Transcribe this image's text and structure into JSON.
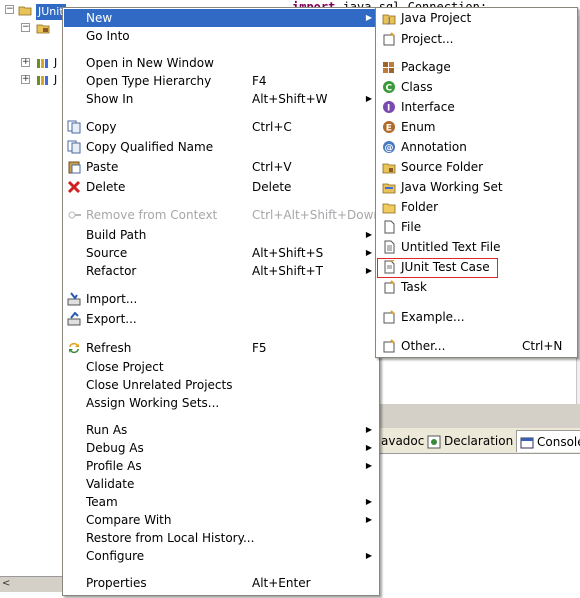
{
  "tree": {
    "selected_label": "JUnit",
    "row2_glyph": "J",
    "row3_glyph": "J"
  },
  "editor": {
    "keyword": "import",
    "code": " java.sql.Connection;"
  },
  "bottom_tabs": [
    {
      "label": "avadoc",
      "icon": "javadoc-icon"
    },
    {
      "label": "Declaration",
      "icon": "declaration-icon"
    },
    {
      "label": "Console",
      "icon": "console-icon"
    }
  ],
  "context_menu": {
    "items": [
      {
        "label": "New",
        "submenu": true,
        "highlight": true
      },
      {
        "label": "Go Into"
      },
      {
        "label": "Open in New Window"
      },
      {
        "label": "Open Type Hierarchy",
        "accel": "F4"
      },
      {
        "label": "Show In",
        "accel": "Alt+Shift+W",
        "submenu": true
      },
      {
        "label": "Copy",
        "accel": "Ctrl+C",
        "icon": "copy-icon"
      },
      {
        "label": "Copy Qualified Name",
        "icon": "copy-qualified-icon"
      },
      {
        "label": "Paste",
        "accel": "Ctrl+V",
        "icon": "paste-icon"
      },
      {
        "label": "Delete",
        "accel": "Delete",
        "icon": "delete-icon"
      },
      {
        "label": "Remove from Context",
        "accel": "Ctrl+Alt+Shift+Down",
        "disabled": true,
        "icon": "remove-context-icon"
      },
      {
        "label": "Build Path",
        "submenu": true
      },
      {
        "label": "Source",
        "accel": "Alt+Shift+S",
        "submenu": true
      },
      {
        "label": "Refactor",
        "accel": "Alt+Shift+T",
        "submenu": true
      },
      {
        "label": "Import...",
        "icon": "import-icon"
      },
      {
        "label": "Export...",
        "icon": "export-icon"
      },
      {
        "label": "Refresh",
        "accel": "F5",
        "icon": "refresh-icon"
      },
      {
        "label": "Close Project"
      },
      {
        "label": "Close Unrelated Projects"
      },
      {
        "label": "Assign Working Sets..."
      },
      {
        "label": "Run As",
        "submenu": true
      },
      {
        "label": "Debug As",
        "submenu": true
      },
      {
        "label": "Profile As",
        "submenu": true
      },
      {
        "label": "Validate"
      },
      {
        "label": "Team",
        "submenu": true
      },
      {
        "label": "Compare With",
        "submenu": true
      },
      {
        "label": "Restore from Local History..."
      },
      {
        "label": "Configure",
        "submenu": true
      },
      {
        "label": "Properties",
        "accel": "Alt+Enter"
      }
    ]
  },
  "new_submenu": {
    "items": [
      {
        "label": "Java Project",
        "icon": "java-project-icon"
      },
      {
        "label": "Project...",
        "icon": "project-icon"
      },
      {
        "label": "Package",
        "icon": "package-icon"
      },
      {
        "label": "Class",
        "icon": "class-icon"
      },
      {
        "label": "Interface",
        "icon": "interface-icon"
      },
      {
        "label": "Enum",
        "icon": "enum-icon"
      },
      {
        "label": "Annotation",
        "icon": "annotation-icon"
      },
      {
        "label": "Source Folder",
        "icon": "source-folder-icon"
      },
      {
        "label": "Java Working Set",
        "icon": "working-set-icon"
      },
      {
        "label": "Folder",
        "icon": "folder-icon"
      },
      {
        "label": "File",
        "icon": "file-icon"
      },
      {
        "label": "Untitled Text File",
        "icon": "text-file-icon"
      },
      {
        "label": "JUnit Test Case",
        "icon": "junit-test-case-icon",
        "outlined": true,
        "outline_color": "#e0282c"
      },
      {
        "label": "Task",
        "icon": "task-icon"
      },
      {
        "label": "Example...",
        "icon": "example-icon"
      },
      {
        "label": "Other...",
        "accel": "Ctrl+N",
        "icon": "other-icon"
      }
    ]
  },
  "colors": {
    "highlight": "#316ac5",
    "disabled_text": "#a7a6aa",
    "junit_outline": "#e0282c",
    "menu_border": "#8a867a"
  }
}
